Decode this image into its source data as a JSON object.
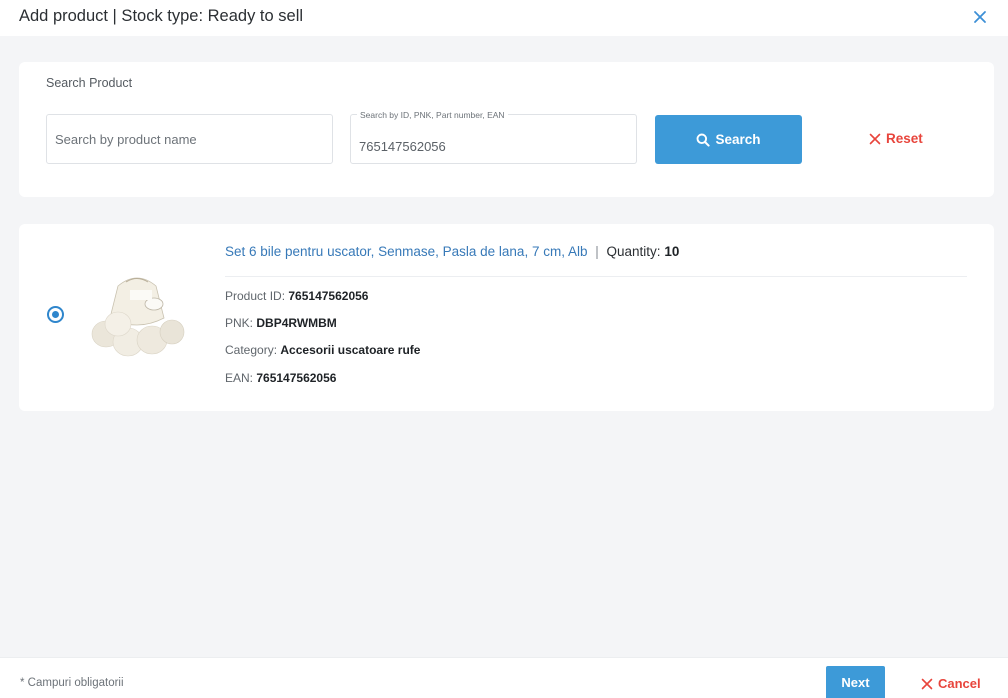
{
  "header": {
    "title": "Add product | Stock type: Ready to sell",
    "close_icon": "close-icon"
  },
  "search": {
    "heading": "Search Product",
    "name_placeholder": "Search by product name",
    "name_value": "",
    "id_legend": "Search by ID, PNK, Part number, EAN",
    "id_value": "765147562056",
    "search_label": "Search",
    "reset_label": "Reset"
  },
  "product": {
    "selected": true,
    "title": "Set 6 bile pentru uscator, Senmase, Pasla de lana, 7 cm, Alb",
    "separator": "|",
    "quantity_label": "Quantity:",
    "quantity_value": "10",
    "product_id_label": "Product ID:",
    "product_id_value": "765147562056",
    "pnk_label": "PNK:",
    "pnk_value": "DBP4RWMBM",
    "category_label": "Category:",
    "category_value": "Accesorii uscatoare rufe",
    "ean_label": "EAN:",
    "ean_value": "765147562056"
  },
  "footer": {
    "required_note": "* Campuri obligatorii",
    "next_label": "Next",
    "cancel_label": "Cancel"
  },
  "colors": {
    "primary": "#3d9ad8",
    "danger": "#e8453c",
    "link": "#3779b8"
  }
}
